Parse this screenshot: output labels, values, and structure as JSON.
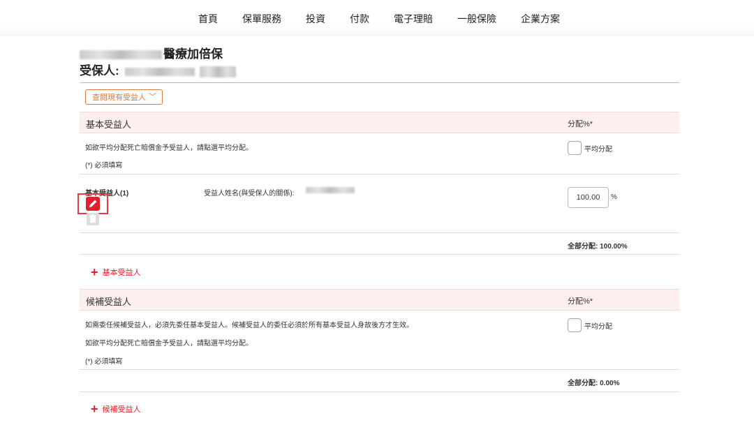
{
  "nav": {
    "items": [
      "首頁",
      "保單服務",
      "投資",
      "付款",
      "電子理賠",
      "一般保險",
      "企業方案"
    ]
  },
  "header": {
    "plan_name": "醫療加倍保",
    "insured_label": "受保人:"
  },
  "dropdown": {
    "label": "查閱現有受益人"
  },
  "basic": {
    "title": "基本受益人",
    "pct_label": "分配%*",
    "equal_label": "平均分配",
    "note": "如欲平均分配死亡賠償金予受益人，請點選平均分配。",
    "required": "(*) 必須填寫",
    "row": {
      "label": "基本受益人(1)",
      "name_label": "受益人姓名(與受保人的關係):",
      "percentage": "100.00",
      "percent_sign": "%"
    },
    "total": "全部分配: 100.00%",
    "add_label": "基本受益人"
  },
  "contingent": {
    "title": "候補受益人",
    "pct_label": "分配%*",
    "equal_label": "平均分配",
    "note1": "如需委任候補受益人，必須先委任基本受益人。候補受益人的委任必須於所有基本受益人身故後方才生效。",
    "note2": "如欲平均分配死亡賠償金予受益人，請點選平均分配。",
    "required": "(*) 必須填寫",
    "total": "全部分配: 0.00%",
    "add_label": "候補受益人"
  },
  "colors": {
    "accent": "#e0202d",
    "orange": "#e07a3a",
    "section_bg": "#fdeff0"
  }
}
